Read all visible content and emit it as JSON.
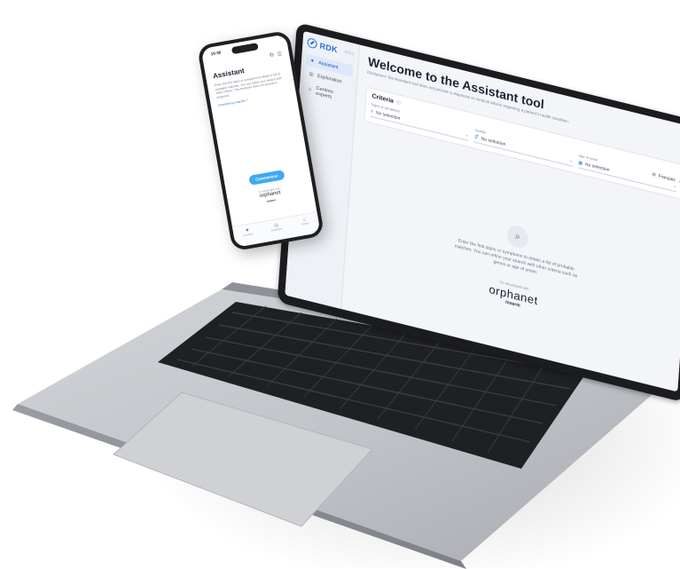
{
  "laptop": {
    "sidebar": {
      "brand": "RDK",
      "version": "v0.0.1",
      "items": [
        {
          "label": "Assistant",
          "icon": "sparkle-icon",
          "active": true
        },
        {
          "label": "Exploration",
          "icon": "compass-icon",
          "active": false
        },
        {
          "label": "Centres experts",
          "icon": "hospital-icon",
          "active": false
        }
      ]
    },
    "main": {
      "title": "Welcome to the Assistant tool",
      "disclaimer": "Disclaimer: the Assistant tool does not provide a diagnosis or medical advice regarding a patient's health condition.",
      "language": "Français",
      "criteria": {
        "title": "Criteria",
        "fields": [
          {
            "label": "Signs or symptoms",
            "value": "No selection",
            "icon": "stethoscope-icon"
          },
          {
            "label": "Gender",
            "value": "No selection",
            "icon": "gender-icon"
          },
          {
            "label": "Age of onset",
            "value": "No selection",
            "icon": "calendar-icon"
          }
        ]
      },
      "empty_state": {
        "text": "Enter the first signs or symptoms to obtain a list of probable matches. You can refine your search with other criteria such as genes or age of onset."
      },
      "developed_with": "Co-developed with",
      "partner": "orphanet",
      "partner2": "Inserm"
    }
  },
  "phone": {
    "time": "19:36",
    "title": "Assistant",
    "description": "Enter the first signs or symptoms to obtain a list of probable matches. You can refine your search with other criteria. The Assistant does not provide a diagnosis.",
    "link": "Comment ça marche ?",
    "button": "Commencer",
    "developed_with": "Co-développé avec",
    "partner": "orphanet",
    "partner2": "Inserm",
    "tabs": [
      {
        "label": "Assistant",
        "icon": "sparkle-icon",
        "active": true
      },
      {
        "label": "Exploration",
        "icon": "compass-icon",
        "active": false
      },
      {
        "label": "Centres",
        "icon": "hospital-icon",
        "active": false
      }
    ]
  },
  "colors": {
    "accent": "#2b6fd6",
    "button": "#3fa9f5",
    "screen_bg": "#f4f5f8",
    "laptop_body": "#b9bcc2"
  }
}
